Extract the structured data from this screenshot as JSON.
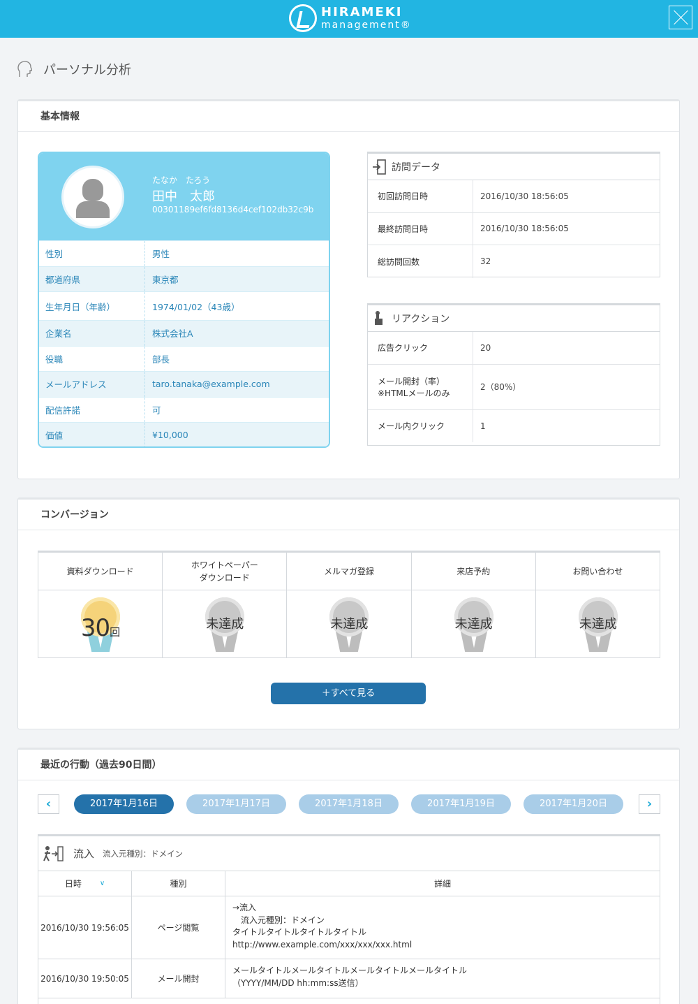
{
  "header": {
    "brand_top": "HIRAMEKI",
    "brand_bottom": "management®"
  },
  "page": {
    "title": "パーソナル分析"
  },
  "basic": {
    "title": "基本情報",
    "profile": {
      "kana": "たなか　たろう",
      "name": "田中　太郎",
      "id": "00301189ef6fd8136d4cef102db32c9b",
      "rows": [
        {
          "label": "性別",
          "value": "男性"
        },
        {
          "label": "都道府県",
          "value": "東京都"
        },
        {
          "label": "生年月日（年齢）",
          "value": "1974/01/02（43歳）"
        },
        {
          "label": "企業名",
          "value": "株式会社A"
        },
        {
          "label": "役職",
          "value": "部長"
        },
        {
          "label": "メールアドレス",
          "value": "taro.tanaka@example.com"
        },
        {
          "label": "配信許諾",
          "value": "可"
        },
        {
          "label": "価値",
          "value": "¥10,000"
        }
      ]
    },
    "visit": {
      "title": "訪問データ",
      "rows": [
        {
          "label": "初回訪問日時",
          "value": "2016/10/30 18:56:05"
        },
        {
          "label": "最終訪問日時",
          "value": "2016/10/30 18:56:05"
        },
        {
          "label": "総訪問回数",
          "value": "32"
        }
      ]
    },
    "reaction": {
      "title": "リアクション",
      "rows": [
        {
          "label": "広告クリック",
          "label2": "",
          "value": "20"
        },
        {
          "label": "メール開封（率）",
          "label2": "※HTMLメールのみ",
          "value": "2（80%）"
        },
        {
          "label": "メール内クリック",
          "label2": "",
          "value": "1"
        }
      ]
    }
  },
  "conversion": {
    "title": "コンバージョン",
    "items": [
      {
        "name": "資料ダウンロード",
        "count": "30",
        "unit": "回",
        "achieved": true
      },
      {
        "name": "ホワイトペーパー\nダウンロード",
        "status": "未達成",
        "achieved": false
      },
      {
        "name": "メルマガ登録",
        "status": "未達成",
        "achieved": false
      },
      {
        "name": "来店予約",
        "status": "未達成",
        "achieved": false
      },
      {
        "name": "お問い合わせ",
        "status": "未達成",
        "achieved": false
      }
    ],
    "see_all": "＋すべて見る"
  },
  "recent": {
    "title": "最近の行動（過去90日間）",
    "prev": "‹",
    "next": "›",
    "dates": [
      "2017年1月16日",
      "2017年1月17日",
      "2017年1月18日",
      "2017年1月19日",
      "2017年1月20日"
    ],
    "active_index": 0,
    "flow": {
      "title": "流入",
      "subtitle": "流入元種別：ドメイン",
      "columns": [
        "日時",
        "種別",
        "詳細"
      ],
      "rows": [
        {
          "datetime": "2016/10/30 19:56:05",
          "type": "ページ閲覧",
          "detail": [
            "→流入",
            "　流入元種別：ドメイン",
            "タイトルタイトルタイトルタイトル",
            "http://www.example.com/xxx/xxx/xxx.html"
          ]
        },
        {
          "datetime": "2016/10/30 19:50:05",
          "type": "メール開封",
          "detail": [
            "メールタイトルメールタイトルメールタイトルメールタイトル",
            "（YYYY/MM/DD hh:mm:ss送信）"
          ]
        }
      ]
    }
  },
  "colors": {
    "header": "#22b5e2",
    "card": "#7fd3ef",
    "primary": "#2472aa",
    "pill": "#a9cde8",
    "gold": "#f5d37a",
    "silver": "#c8c8c8"
  }
}
